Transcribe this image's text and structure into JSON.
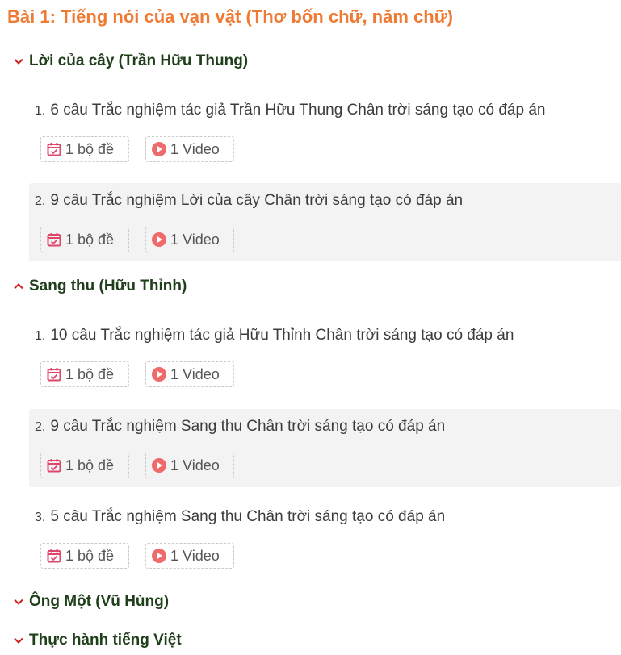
{
  "title": "Bài 1: Tiếng nói của vạn vật (Thơ bốn chữ, năm chữ)",
  "colors": {
    "title": "#ef7a33",
    "section": "#1f3f1a",
    "chevron": "#d11f1f",
    "exam_icon": "#e0456a",
    "video_icon": "#ef6b6b"
  },
  "sections": [
    {
      "label": "Lời của cây (Trần Hữu Thung)",
      "expanded": true,
      "items": [
        {
          "num": "1.",
          "title": "6 câu Trắc nghiệm tác giả Trần Hữu Thung Chân trời sáng tạo có đáp án",
          "exam": "1 bộ đề",
          "video": "1 Video"
        },
        {
          "num": "2.",
          "title": "9 câu Trắc nghiệm Lời của cây Chân trời sáng tạo có đáp án",
          "exam": "1 bộ đề",
          "video": "1 Video"
        }
      ]
    },
    {
      "label": "Sang thu (Hữu Thỉnh)",
      "expanded": true,
      "items": [
        {
          "num": "1.",
          "title": "10 câu Trắc nghiệm tác giả Hữu Thỉnh Chân trời sáng tạo có đáp án",
          "exam": "1 bộ đề",
          "video": "1 Video"
        },
        {
          "num": "2.",
          "title": "9 câu Trắc nghiệm Sang thu Chân trời sáng tạo có đáp án",
          "exam": "1 bộ đề",
          "video": "1 Video"
        },
        {
          "num": "3.",
          "title": "5 câu Trắc nghiệm Sang thu Chân trời sáng tạo có đáp án",
          "exam": "1 bộ đề",
          "video": "1 Video"
        }
      ]
    },
    {
      "label": "Ông Một (Vũ Hùng)",
      "expanded": false,
      "items": []
    },
    {
      "label": "Thực hành tiếng Việt",
      "expanded": false,
      "items": []
    }
  ],
  "icons": {
    "chevron_down": "chevron-down-icon",
    "chevron_up": "chevron-up-icon",
    "exam": "calendar-check-icon",
    "video": "play-circle-icon"
  }
}
